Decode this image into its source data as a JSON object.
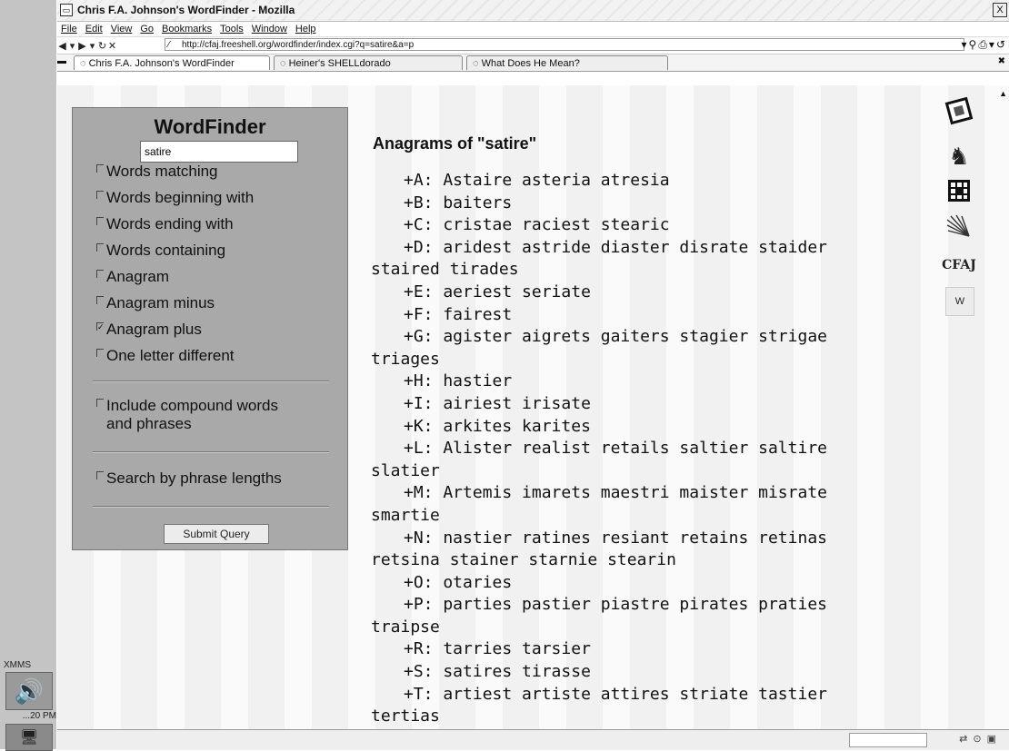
{
  "desktop": {
    "xmms_label": "XMMS",
    "clock": "...20 PM",
    "xmms_icon": "speaker-icon",
    "tray_icon": "computer-icon"
  },
  "window": {
    "title": "Chris F.A. Johnson's WordFinder - Mozilla",
    "close_glyph": "X"
  },
  "menubar": [
    "File",
    "Edit",
    "View",
    "Go",
    "Bookmarks",
    "Tools",
    "Window",
    "Help"
  ],
  "toolbar": {
    "url": "http://cfaj.freeshell.org/wordfinder/index.cgi?q=satire&a=p"
  },
  "tabs": [
    "Chris F.A. Johnson's WordFinder",
    "Heiner's SHELLdorado",
    "What Does He Mean?"
  ],
  "form": {
    "title": "WordFinder",
    "query": "satire",
    "options": [
      {
        "label": "Words matching",
        "checked": false
      },
      {
        "label": "Words beginning with",
        "checked": false
      },
      {
        "label": "Words ending with",
        "checked": false
      },
      {
        "label": "Words containing",
        "checked": false
      },
      {
        "label": "Anagram",
        "checked": false
      },
      {
        "label": "Anagram minus",
        "checked": false
      },
      {
        "label": "Anagram plus",
        "checked": true
      },
      {
        "label": "One letter different",
        "checked": false
      }
    ],
    "compound_line1": "Include compound words",
    "compound_line2": "and phrases",
    "phrase_lengths": "Search by phrase lengths",
    "submit": "Submit Query"
  },
  "results": {
    "heading": "Anagrams of \"satire\"",
    "lines": [
      "+A: Astaire asteria atresia",
      "+B: baiters",
      "+C: cristae raciest stearic",
      "+D: aridest astride diaster disrate staider",
      "staired tirades",
      "+E: aeriest seriate",
      "+F: fairest",
      "+G: agister aigrets gaiters stagier strigae",
      "triages",
      "+H: hastier",
      "+I: airiest irisate",
      "+K: arkites karites",
      "+L: Alister realist retails saltier saltire",
      "slatier",
      "+M: Artemis imarets maestri maister misrate",
      "smartie",
      "+N: nastier ratines resiant retains retinas",
      "retsina stainer starnie stearin",
      "+O: otaries",
      "+P: parties pastier piastre pirates praties",
      "traipse",
      "+R: tarries tarsier",
      "+S: satires tirasse",
      "+T: artiest artiste attires striate tastier",
      "tertias"
    ]
  },
  "sidebar_icons": [
    "crossword-icon",
    "knight-icon",
    "grid-icon",
    "fan-icon",
    "cfaj-logo",
    "wordfinder-logo"
  ],
  "sidebar_text": {
    "cfaj": "CFAJ",
    "w": "W"
  }
}
